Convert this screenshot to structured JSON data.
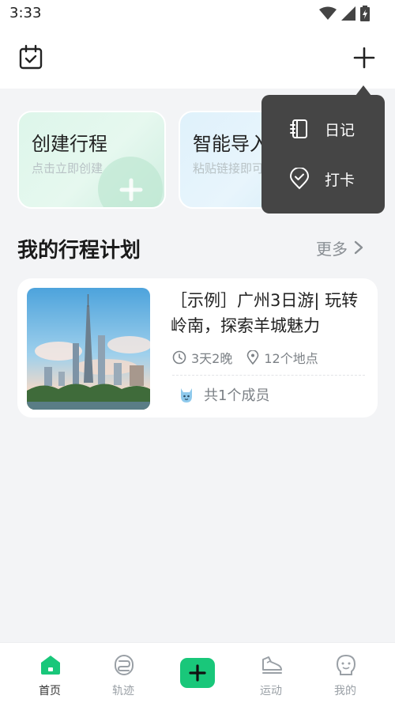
{
  "status_bar": {
    "time": "3:33"
  },
  "quick_actions": {
    "create": {
      "title": "创建行程",
      "subtitle": "点击立即创建"
    },
    "import": {
      "title": "智能导入",
      "subtitle": "粘贴链接即可"
    }
  },
  "section": {
    "title": "我的行程计划",
    "more_label": "更多"
  },
  "trip": {
    "title": "［示例］广州3日游| 玩转岭南，探索羊城魅力",
    "duration": "3天2晚",
    "places": "12个地点",
    "members": "共1个成员"
  },
  "popup_menu": {
    "items": [
      {
        "label": "日记",
        "icon": "notebook-icon"
      },
      {
        "label": "打卡",
        "icon": "checkin-pin-icon"
      }
    ]
  },
  "bottom_nav": {
    "items": [
      {
        "label": "首页",
        "icon": "home-icon",
        "active": true
      },
      {
        "label": "轨迹",
        "icon": "route-icon",
        "active": false
      },
      {
        "label": "",
        "icon": "add-icon",
        "active": false
      },
      {
        "label": "运动",
        "icon": "sneaker-icon",
        "active": false
      },
      {
        "label": "我的",
        "icon": "profile-icon",
        "active": false
      }
    ]
  },
  "colors": {
    "accent": "#19c77a",
    "popup_bg": "#454545",
    "background": "#f3f4f6"
  }
}
